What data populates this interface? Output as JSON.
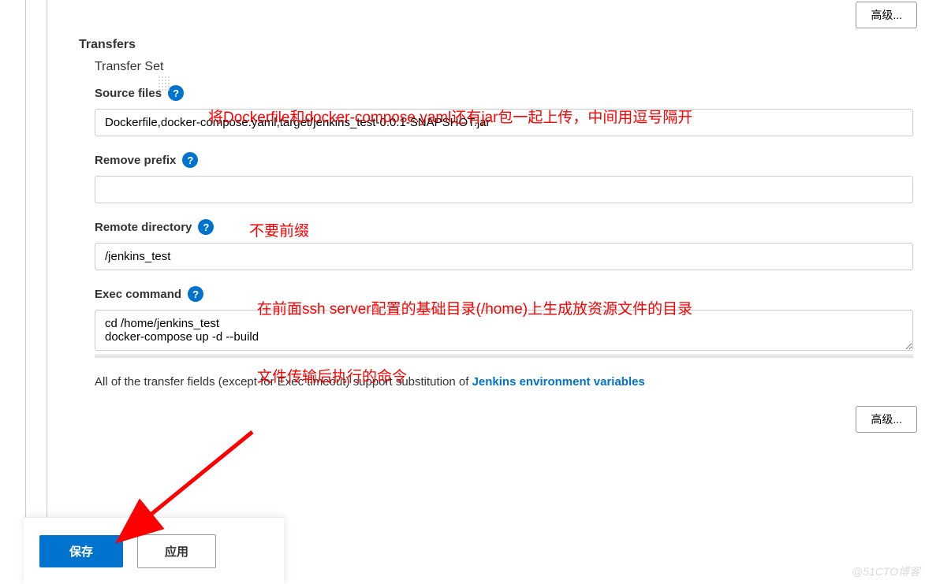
{
  "buttons": {
    "advanced": "高级...",
    "save": "保存",
    "apply": "应用"
  },
  "section_title": "Transfers",
  "card_title": "Transfer Set",
  "fields": {
    "source_files": {
      "label": "Source files",
      "value": "Dockerfile,docker-compose.yaml,target/jenkins_test-0.0.1-SNAPSHOT.jar"
    },
    "remove_prefix": {
      "label": "Remove prefix",
      "value": ""
    },
    "remote_dir": {
      "label": "Remote directory",
      "value": "/jenkins_test"
    },
    "exec_cmd": {
      "label": "Exec command",
      "value": "cd /home/jenkins_test\ndocker-compose up -d --build"
    }
  },
  "info": {
    "prefix": "All of the transfer fields (except for Exec timeout) support substitution of ",
    "link": "Jenkins environment variables"
  },
  "annotations": {
    "a1": "将Dockerfile和docker-compose.yaml还有jar包一起上传，中间用逗号隔开",
    "a2": "不要前缀",
    "a3": "在前面ssh server配置的基础目录(/home)上生成放资源文件的目录",
    "a4": "文件传输后执行的命令"
  },
  "watermark": "@51CTO博客"
}
